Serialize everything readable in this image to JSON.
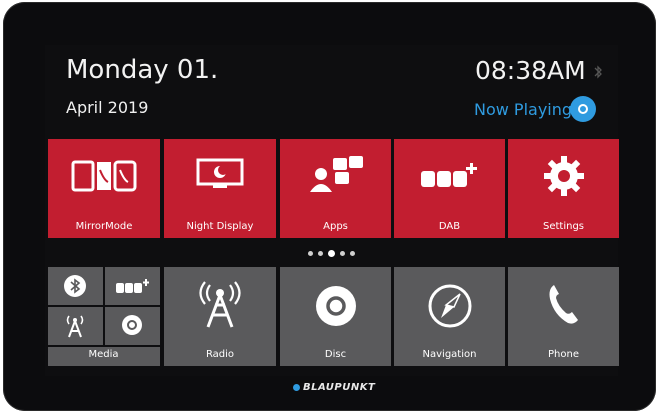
{
  "header": {
    "date_line1": "Monday 01.",
    "date_line2": "April 2019",
    "time": "08:38AM",
    "now_playing": "Now Playing"
  },
  "top_tiles": [
    {
      "label": "MirrorMode",
      "icon": "mirror-mode-icon"
    },
    {
      "label": "Night Display",
      "icon": "night-display-icon"
    },
    {
      "label": "Apps",
      "icon": "apps-icon"
    },
    {
      "label": "DAB",
      "icon": "dab-plus-icon"
    },
    {
      "label": "Settings",
      "icon": "gear-icon"
    }
  ],
  "pager": {
    "count": 5,
    "active_index": 2
  },
  "bottom_tiles": [
    {
      "label": "Media",
      "icon": "media-icon",
      "subicons": [
        "bluetooth-icon",
        "dab-plus-icon",
        "radio-antenna-icon",
        "disc-icon"
      ]
    },
    {
      "label": "Radio",
      "icon": "radio-antenna-icon"
    },
    {
      "label": "Disc",
      "icon": "disc-icon"
    },
    {
      "label": "Navigation",
      "icon": "navigation-compass-icon"
    },
    {
      "label": "Phone",
      "icon": "phone-icon"
    }
  ],
  "brand": "BLAUPUNKT",
  "colors": {
    "accent_red": "#c21e30",
    "tile_grey": "#5a5a5c",
    "accent_blue": "#2f9be0",
    "background": "#0e0e10"
  }
}
